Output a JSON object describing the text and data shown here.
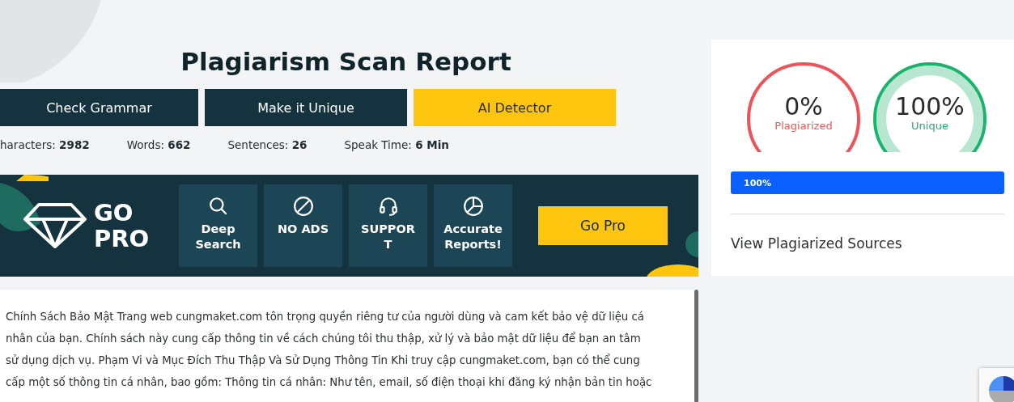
{
  "title": "Plagiarism Scan Report",
  "actions": [
    {
      "label": "Check Grammar",
      "kind": "dark"
    },
    {
      "label": "Make it Unique",
      "kind": "dark"
    },
    {
      "label": "AI Detector",
      "kind": "accent"
    }
  ],
  "stats": [
    {
      "label": "haracters:",
      "value": "2982"
    },
    {
      "label": "Words:",
      "value": "662"
    },
    {
      "label": "Sentences:",
      "value": "26"
    },
    {
      "label": "Speak Time:",
      "value": "6 Min"
    }
  ],
  "promo": {
    "logo_lines": [
      "GO",
      "PRO"
    ],
    "features": [
      {
        "kind": "search",
        "label": "Deep Search"
      },
      {
        "kind": "ban",
        "label": "NO ADS"
      },
      {
        "kind": "headset",
        "label": "SUPPOR T"
      },
      {
        "kind": "pie",
        "label": "Accurate Reports!"
      }
    ],
    "button": "Go Pro"
  },
  "content_lines": [
    "Chính Sách Bảo Mật Trang web cungmaket.com tôn trọng quyền riêng tư của người dùng và cam kết bảo vệ dữ liệu cá",
    "nhân của bạn. Chính sách này cung cấp thông tin về cách chúng tôi thu thập, xử lý và bảo mật dữ liệu để bạn an tâm",
    "sử dụng dịch vụ. Phạm Vi và Mục Đích Thu Thập Và Sử Dụng Thông Tin Khi truy cập cungmaket.com, bạn có thể cung",
    "cấp một số thông tin cá nhân, bao gồm: Thông tin cá nhân: Như tên, email, số điện thoại khi đăng ký nhận bản tin hoặc"
  ],
  "results": {
    "gauges": [
      {
        "value": "0%",
        "label": "Plagiarized",
        "color": "#ef5358"
      },
      {
        "value": "100%",
        "label": "Unique",
        "color": "#18b46b"
      }
    ],
    "progress": {
      "level": 1,
      "reading": "100%"
    },
    "sources_link": "View Plagiarized Sources"
  }
}
